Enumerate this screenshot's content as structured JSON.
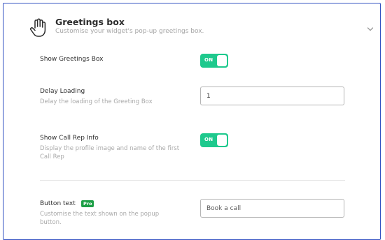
{
  "section": {
    "title": "Greetings box",
    "subtitle": "Customise your widget's pop-up greetings box."
  },
  "settings": {
    "show_greetings_box": {
      "label": "Show Greetings Box",
      "toggle_text": "ON",
      "enabled": true
    },
    "delay_loading": {
      "label": "Delay Loading",
      "description": "Delay the loading of the Greeting Box",
      "value": "1"
    },
    "show_call_rep_info": {
      "label": "Show Call Rep Info",
      "description_line1": "Display the profile image and name of the first",
      "description_line2": "Call Rep",
      "toggle_text": "ON",
      "enabled": true
    },
    "button_text": {
      "label": "Button text",
      "badge": "Pro",
      "description_line1": "Customise the text shown on the popup",
      "description_line2": "button.",
      "placeholder": "Book a call"
    }
  },
  "icons": {
    "header": "hand-icon",
    "collapse": "chevron-down-icon"
  },
  "colors": {
    "panel_border": "#3352c2",
    "toggle_on": "#1ec98d",
    "pro_badge": "#1d9f46"
  }
}
